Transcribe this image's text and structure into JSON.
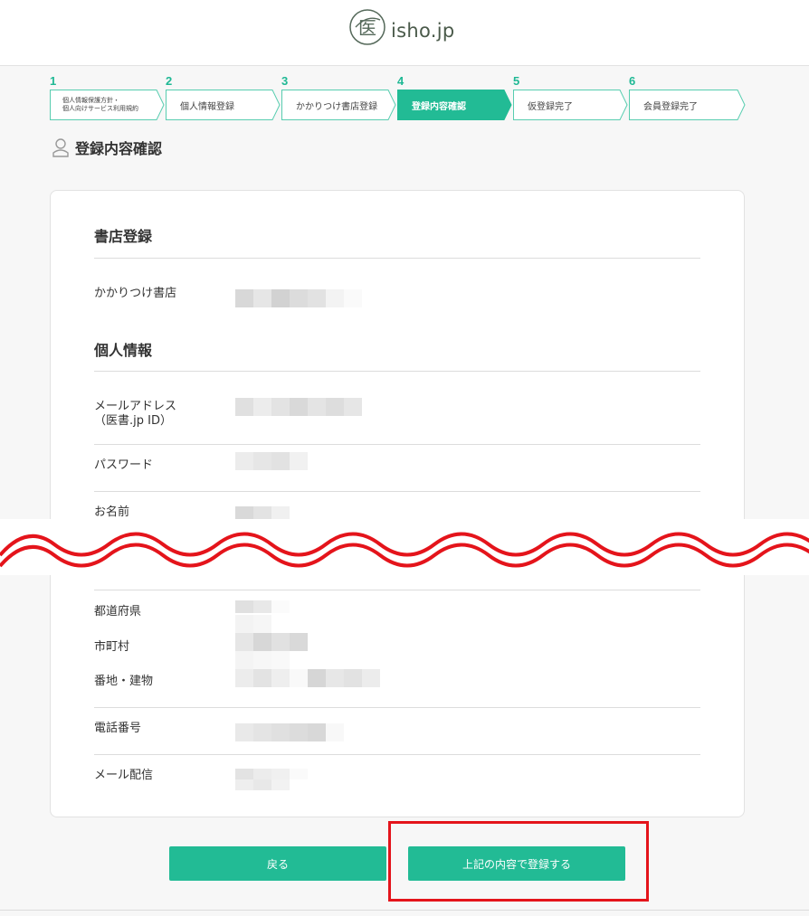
{
  "header": {
    "logo_text": "isho.jp",
    "logo_mark": "医"
  },
  "steps": [
    {
      "num": "1",
      "label": "個人情報保護方針・\n個人向けサービス利用規約",
      "active": false
    },
    {
      "num": "2",
      "label": "個人情報登録",
      "active": false
    },
    {
      "num": "3",
      "label": "かかりつけ書店登録",
      "active": false
    },
    {
      "num": "4",
      "label": "登録内容確認",
      "active": true
    },
    {
      "num": "5",
      "label": "仮登録完了",
      "active": false
    },
    {
      "num": "6",
      "label": "会員登録完了",
      "active": false
    }
  ],
  "page_title": "登録内容確認",
  "sections": {
    "bookstore": {
      "title": "書店登録",
      "bookstore_label": "かかりつけ書店"
    },
    "personal": {
      "title": "個人情報",
      "email_label": "メールアドレス",
      "email_sublabel": "（医書.jp ID）",
      "password_label": "パスワード",
      "name_label": "お名前",
      "prefecture_label": "都道府県",
      "city_label": "市町村",
      "address_label": "番地・建物",
      "phone_label": "電話番号",
      "mail_delivery_label": "メール配信"
    }
  },
  "buttons": {
    "back": "戻る",
    "submit": "上記の内容で登録する"
  },
  "colors": {
    "accent": "#22bb95",
    "highlight": "#e4141b",
    "wave": "#e4141b"
  }
}
